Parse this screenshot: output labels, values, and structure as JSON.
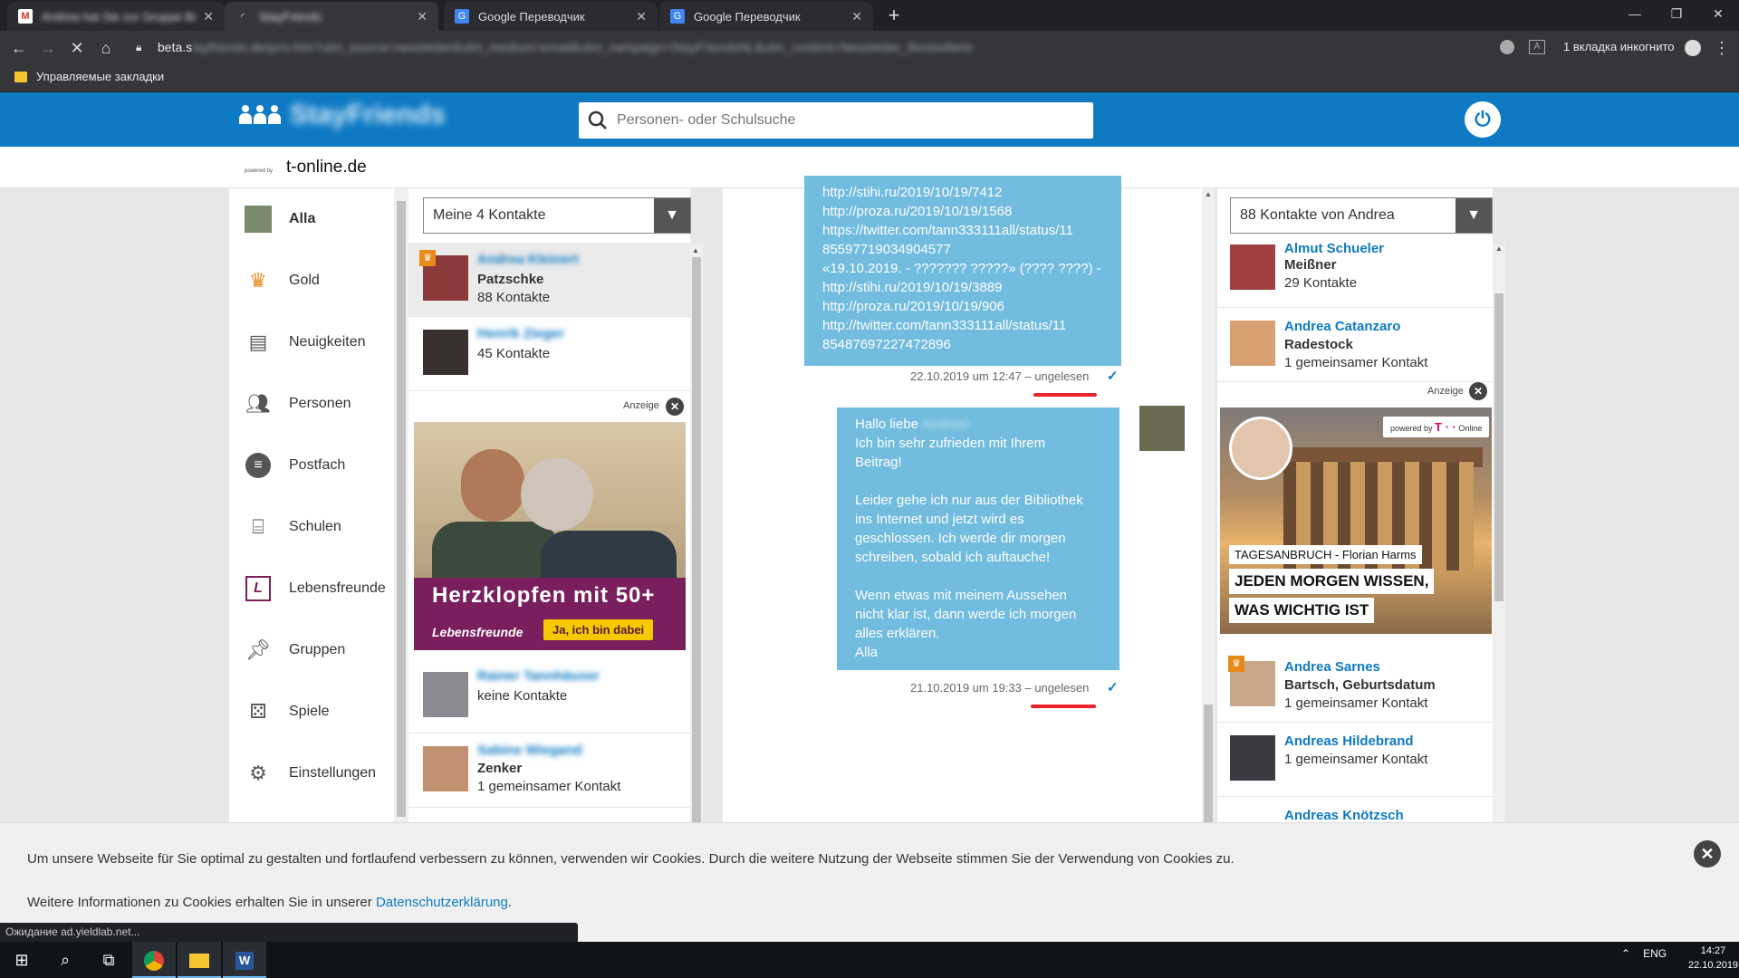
{
  "browser": {
    "tabs": [
      {
        "title": "Andrea hat Sie zur Gruppe Beiu...",
        "icon": "gmail-icon",
        "blurred": true
      },
      {
        "title": "StayFriends",
        "icon": "loading-icon",
        "blurred": true
      },
      {
        "title": "Google Переводчик",
        "icon": "google-translate-icon"
      },
      {
        "title": "Google Переводчик",
        "icon": "google-translate-icon"
      }
    ],
    "url_visible": "beta.s",
    "url_blurred": "tayfriends.de/pr/s.htm?utm_source=newsletter&utm_medium=email&utm_campaign=StayFriendsNL&utm_content=Newsletter_Bestsellerie",
    "incognito_label": "1 вкладка инкогнито",
    "bookmark_folder": "Управляемые закладки"
  },
  "site": {
    "logo_text": "StayFriends",
    "search_placeholder": "Personen- oder Schulsuche",
    "powered_by": "powered by",
    "partner": "t-online.de"
  },
  "sidebar": {
    "items": [
      {
        "label": "Alla",
        "icon": "user-avatar-icon",
        "active": true
      },
      {
        "label": "Gold",
        "icon": "crown-icon"
      },
      {
        "label": "Neuigkeiten",
        "icon": "news-icon"
      },
      {
        "label": "Personen",
        "icon": "people-icon"
      },
      {
        "label": "Postfach",
        "icon": "mailbox-icon"
      },
      {
        "label": "Schulen",
        "icon": "school-icon"
      },
      {
        "label": "Lebensfreunde",
        "icon": "lebensfreunde-icon"
      },
      {
        "label": "Gruppen",
        "icon": "pin-icon"
      },
      {
        "label": "Spiele",
        "icon": "dice-icon"
      },
      {
        "label": "Einstellungen",
        "icon": "gear-icon"
      }
    ]
  },
  "contacts": {
    "dropdown": "Meine 4 Kontakte",
    "items": [
      {
        "name": "Andrea Kleinert",
        "line2": "Patzschke",
        "line3": "88 Kontakte",
        "gold": true
      },
      {
        "name": "Henrik Zieger",
        "line2": "45 Kontakte"
      },
      {
        "name": "Rainer Tannhäuser",
        "line2": "keine Kontakte"
      },
      {
        "name": "Sabine Wiegand",
        "line2": "Zenker",
        "line3": "1 gemeinsamer Kontakt"
      }
    ],
    "ad": {
      "label": "Anzeige",
      "headline": "Herzklopfen mit 50+",
      "brand": "Lebensfreunde",
      "cta": "Ja, ich bin dabei"
    }
  },
  "chat": {
    "message1": {
      "lines": [
        "http://stihi.ru/2019/10/19/7412",
        "http://proza.ru/2019/10/19/1568",
        "https://twitter.com/tann333111all/status/11",
        "85597719034904577",
        "«19.10.2019. - ??????? ?????» (???? ????) -",
        "http://stihi.ru/2019/10/19/3889",
        "http://proza.ru/2019/10/19/906",
        "http://twitter.com/tann333111all/status/11",
        "85487697227472896"
      ],
      "timestamp": "22.10.2019 um 12:47 – ungelesen"
    },
    "message2": {
      "greeting": "Hallo liebe",
      "greeting_name": "Andrea!",
      "lines": [
        "Ich bin sehr zufrieden mit Ihrem",
        "Beitrag!",
        "",
        "Leider gehe ich nur aus der Bibliothek",
        "ins Internet und jetzt wird es",
        "geschlossen. Ich werde dir morgen",
        "schreiben, sobald ich auftauche!",
        "",
        "Wenn etwas mit meinem Aussehen",
        "nicht klar ist, dann werde ich morgen",
        "alles erklären.",
        "Alla"
      ],
      "timestamp": "21.10.2019 um 19:33 – ungelesen"
    }
  },
  "right": {
    "dropdown": "88 Kontakte von Andrea",
    "items": [
      {
        "name": "Almut Schueler",
        "line2": "Meißner",
        "line3": "29 Kontakte"
      },
      {
        "name": "Andrea Catanzaro",
        "line2": "Radestock",
        "line3": "1 gemeinsamer Kontakt"
      },
      {
        "name": "Andrea Sarnes",
        "line2": "Bartsch, Geburtsdatum",
        "line3": "1 gemeinsamer Kontakt",
        "gold": true
      },
      {
        "name": "Andreas Hildebrand",
        "line2": "1 gemeinsamer Kontakt"
      },
      {
        "name": "Andreas Knötzsch"
      }
    ],
    "ad": {
      "label": "Anzeige",
      "badge_prefix": "powered by",
      "badge_brand": "T · ·",
      "badge_suffix": "Online",
      "line1": "TAGESANBRUCH - Florian Harms",
      "line2": "JEDEN MORGEN WISSEN,",
      "line3": "WAS WICHTIG IST"
    }
  },
  "cookie": {
    "text1": "Um unsere Webseite für Sie optimal zu gestalten und fortlaufend verbessern zu können, verwenden wir Cookies. Durch die weitere Nutzung der Webseite stimmen Sie der Verwendung von Cookies zu.",
    "text2_prefix": "Weitere Informationen zu Cookies erhalten Sie in unserer ",
    "link": "Datenschutzerklärung",
    "text2_suffix": "."
  },
  "statusbar": "Ожидание ad.yieldlab.net...",
  "taskbar": {
    "lang": "ENG",
    "time": "14:27",
    "date": "22.10.2019"
  },
  "colors": {
    "brand_blue": "#0e7ac4",
    "bubble": "#72bcdf",
    "unread_marker": "#e8232a"
  }
}
